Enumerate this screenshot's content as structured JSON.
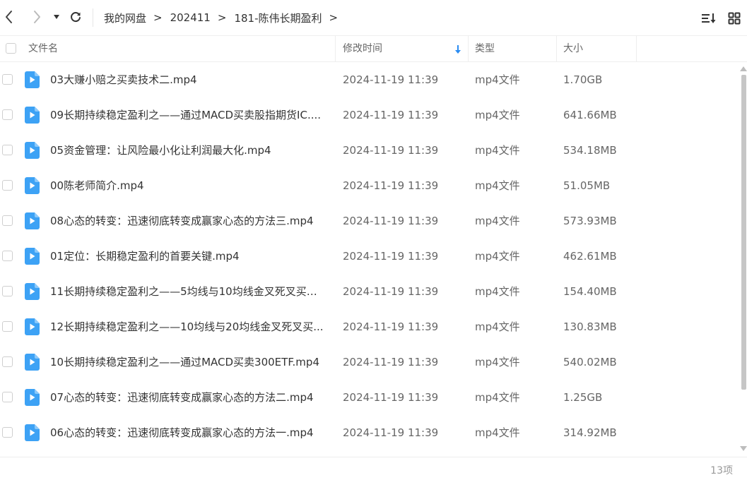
{
  "nav": {
    "back_icon": "chevron-left-icon",
    "forward_icon": "chevron-right-icon",
    "history_icon": "caret-down-icon",
    "refresh_icon": "refresh-icon"
  },
  "breadcrumb": [
    {
      "label": "我的网盘"
    },
    {
      "label": "202411"
    },
    {
      "label": "181-陈伟长期盈利"
    }
  ],
  "toolbar": {
    "sort_icon": "sort-list-icon",
    "grid_icon": "grid-view-icon"
  },
  "columns": {
    "name": "文件名",
    "modified": "修改时间",
    "type": "类型",
    "size": "大小"
  },
  "colors": {
    "file_icon": "#3DA2F5",
    "sort_arrow": "#2A8CF2"
  },
  "files": [
    {
      "name": "03大赚小赔之买卖技术二.mp4",
      "modified": "2024-11-19 11:39",
      "type": "mp4文件",
      "size": "1.70GB"
    },
    {
      "name": "09长期持续稳定盈利之——通过MACD买卖股指期货IC....",
      "modified": "2024-11-19 11:39",
      "type": "mp4文件",
      "size": "641.66MB"
    },
    {
      "name": "05资金管理：让风险最小化让利润最大化.mp4",
      "modified": "2024-11-19 11:39",
      "type": "mp4文件",
      "size": "534.18MB"
    },
    {
      "name": "00陈老师简介.mp4",
      "modified": "2024-11-19 11:39",
      "type": "mp4文件",
      "size": "51.05MB"
    },
    {
      "name": "08心态的转变：迅速彻底转变成赢家心态的方法三.mp4",
      "modified": "2024-11-19 11:39",
      "type": "mp4文件",
      "size": "573.93MB"
    },
    {
      "name": "01定位：长期稳定盈利的首要关键.mp4",
      "modified": "2024-11-19 11:39",
      "type": "mp4文件",
      "size": "462.61MB"
    },
    {
      "name": "11长期持续稳定盈利之——5均线与10均线金叉死叉买卖...",
      "modified": "2024-11-19 11:39",
      "type": "mp4文件",
      "size": "154.40MB"
    },
    {
      "name": "12长期持续稳定盈利之——10均线与20均线金叉死叉买...",
      "modified": "2024-11-19 11:39",
      "type": "mp4文件",
      "size": "130.83MB"
    },
    {
      "name": "10长期持续稳定盈利之——通过MACD买卖300ETF.mp4",
      "modified": "2024-11-19 11:39",
      "type": "mp4文件",
      "size": "540.02MB"
    },
    {
      "name": "07心态的转变：迅速彻底转变成赢家心态的方法二.mp4",
      "modified": "2024-11-19 11:39",
      "type": "mp4文件",
      "size": "1.25GB"
    },
    {
      "name": "06心态的转变：迅速彻底转变成赢家心态的方法一.mp4",
      "modified": "2024-11-19 11:39",
      "type": "mp4文件",
      "size": "314.92MB"
    }
  ],
  "footer": {
    "count": "13项"
  }
}
